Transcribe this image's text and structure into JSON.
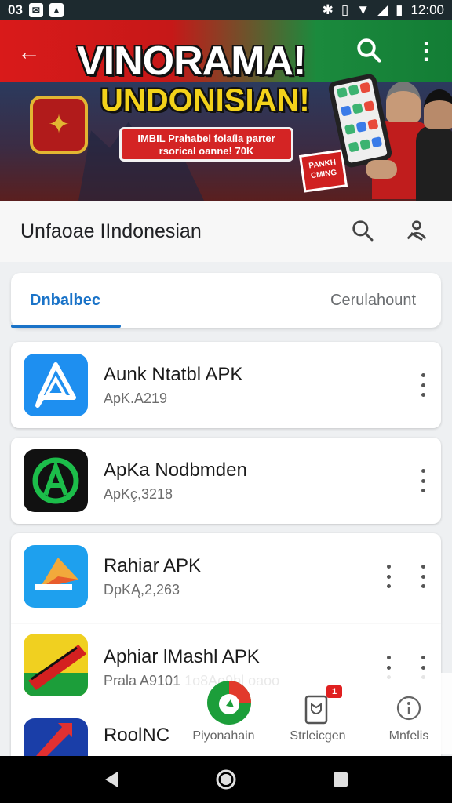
{
  "status_bar": {
    "left_text": "03",
    "time": "12:00"
  },
  "banner": {
    "title": "VINORAMA!",
    "subtitle": "UNDONISIAN!",
    "pill_text": "IMBIL Prahabel folaíia parter rsorical oanne! 70K",
    "sticker_text": "PANKH CMING",
    "emblem": "garuda-emblem"
  },
  "app_bar": {
    "title": "Unfaoae  IIndonesian"
  },
  "tabs": [
    {
      "label": "Dnbalbec",
      "active": true
    },
    {
      "label": "Cerulahount",
      "active": false
    }
  ],
  "apps": [
    {
      "name": "Aunk Ntatbl APK",
      "sub": "ApK.A219",
      "icon": "triangle-chat-icon",
      "color": "#1e8ff0"
    },
    {
      "name": "ApKa Nodbmden",
      "sub": "ApKç,3218",
      "icon": "a-chat-icon",
      "color": "#1cbd4a"
    },
    {
      "name": "Rahiar APK",
      "sub": "DpKĄ,2,263",
      "icon": "play-arrow-icon",
      "color": "#1ea0ee"
    },
    {
      "name": "Aphiar lMashl APK",
      "sub": "Prala  A9101  1o8Ao9bl oaoo",
      "icon": "flag-banner-icon",
      "color": "#f0d020"
    },
    {
      "name": "RoolNC",
      "sub": "",
      "icon": "red-arrow-icon",
      "color": "#1a3ea8"
    }
  ],
  "bottom_nav": [
    {
      "label": "Piyonahain",
      "icon": "green-circle-logo"
    },
    {
      "label": "Strleicgen",
      "icon": "shield-phone-icon",
      "badge": "1"
    },
    {
      "label": "Mnfelis",
      "icon": "info-circle-icon"
    }
  ],
  "colors": {
    "accent": "#1a73c8",
    "banner_red": "#d91a1a",
    "banner_green": "#1b8a3d"
  }
}
